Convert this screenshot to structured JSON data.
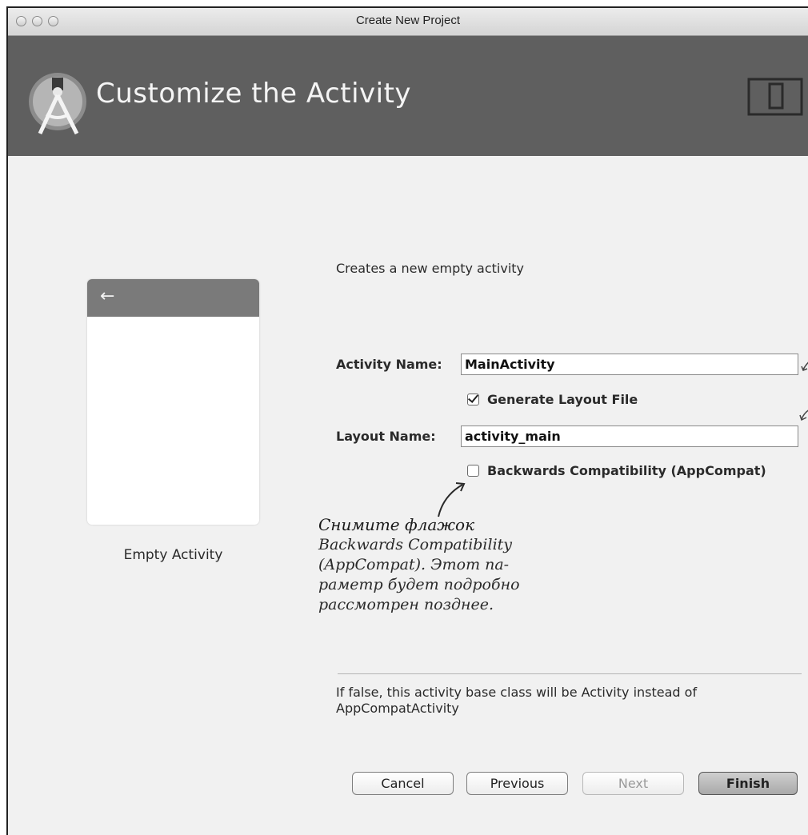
{
  "window": {
    "title": "Create New Project"
  },
  "header": {
    "title": "Customize the Activity"
  },
  "preview": {
    "back_arrow": "←",
    "label": "Empty Activity"
  },
  "form": {
    "description": "Creates a new empty activity",
    "activity_name_label": "Activity Name:",
    "activity_name_value": "MainActivity",
    "generate_layout_label": "Generate Layout File",
    "generate_layout_checked": true,
    "layout_name_label": "Layout Name:",
    "layout_name_value": "activity_main",
    "appcompat_label": "Backwards Compatibility (AppCompat)",
    "appcompat_checked": false
  },
  "annotation": {
    "heading": "Снимите флажок",
    "lines": [
      "Backwards Compatibility",
      "(AppCompat). Этот па-",
      "раметр  будет подробно",
      "рассмотрен позднее."
    ]
  },
  "help_text": "If false, this activity base class will be Activity instead of AppCompatActivity",
  "buttons": {
    "cancel": "Cancel",
    "previous": "Previous",
    "next": "Next",
    "finish": "Finish"
  },
  "colors": {
    "header_bg": "#5f5f5f",
    "content_bg": "#f1f1f1",
    "preview_bar": "#7a7a7a"
  }
}
